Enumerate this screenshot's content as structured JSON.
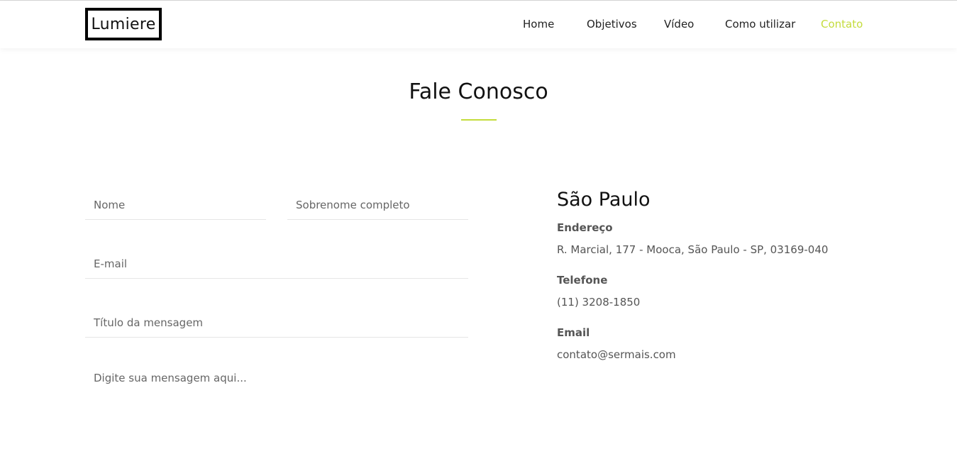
{
  "brand": {
    "logo_text": "Lumiere"
  },
  "nav": {
    "items": [
      {
        "label": "Home"
      },
      {
        "label": "Objetivos"
      },
      {
        "label": "Vídeo"
      },
      {
        "label": "Como utilizar"
      },
      {
        "label": "Contato",
        "active": true
      }
    ]
  },
  "colors": {
    "accent": "#c4dc3c"
  },
  "contact_section": {
    "title": "Fale Conosco",
    "form": {
      "first_name_placeholder": "Nome",
      "last_name_placeholder": "Sobrenome completo",
      "email_placeholder": "E-mail",
      "subject_placeholder": "Título da mensagem",
      "message_placeholder": "Digite sua mensagem aqui..."
    },
    "info": {
      "city": "São Paulo",
      "address_label": "Endereço",
      "address": "R. Marcial, 177 - Mooca, São Paulo - SP, 03169-040",
      "phone_label": "Telefone",
      "phone": "(11) 3208-1850",
      "email_label": "Email",
      "email": "contato@sermais.com"
    }
  }
}
